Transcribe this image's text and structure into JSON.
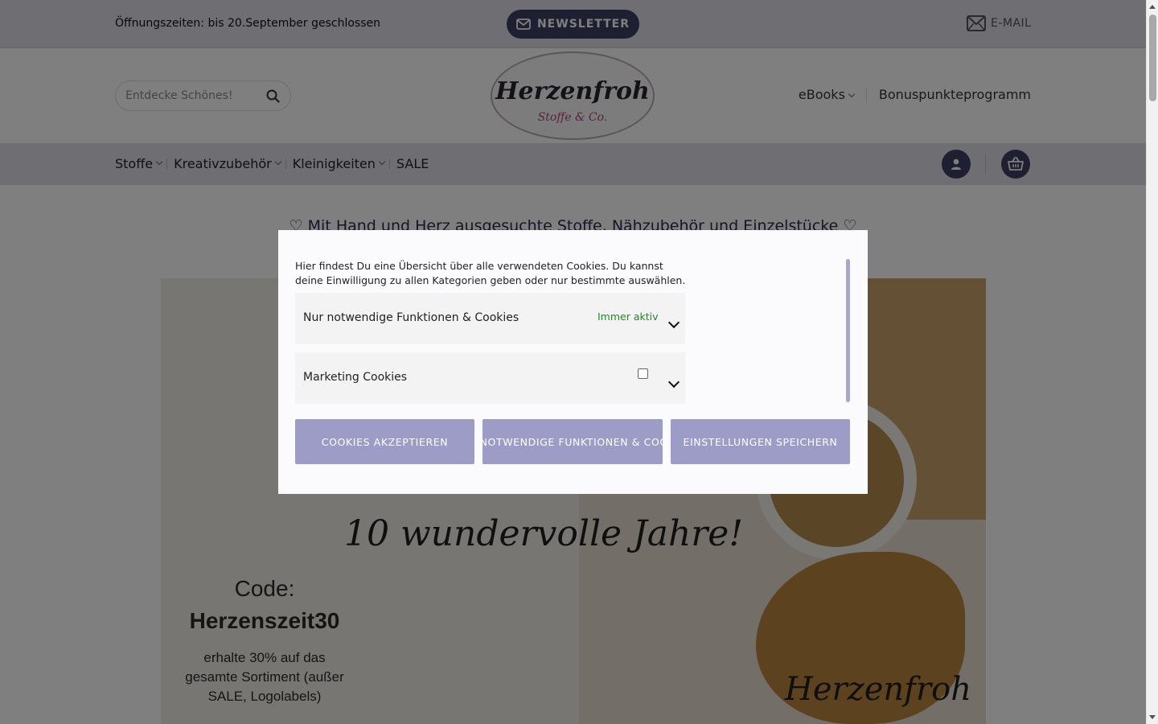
{
  "topbar": {
    "hours": "Öffnungszeiten: bis 20.September geschlossen",
    "newsletter_label": "NEWSLETTER",
    "email_label": "E-MAIL"
  },
  "header": {
    "search_placeholder": "Entdecke Schönes!",
    "logo_line1": "Herzenfroh",
    "logo_line2": "Stoffe & Co.",
    "links": [
      "eBooks",
      "Bonuspunkteprogramm"
    ]
  },
  "nav": {
    "items": [
      "Stoffe",
      "Kreativzubehör",
      "Kleinigkeiten",
      "SALE"
    ]
  },
  "tagline": "♡ Mit Hand und Herz ausgesuchte Stoffe, Nähzubehör und Einzelstücke ♡",
  "hero": {
    "script": "10 wundervolle Jahre!",
    "code_heading": "Code:",
    "code_value": "Herzenszeit30",
    "code_desc": "erhalte 30% auf das gesamte Sortiment (außer SALE, Logolabels)",
    "signature": "Herzenfroh"
  },
  "cookie": {
    "intro": "Hier findest Du eine Übersicht über alle verwendeten Cookies. Du kannst deine Einwilligung zu allen Kategorien geben oder nur bestimmte auswählen.",
    "categories": [
      {
        "title": "Nur notwendige Funktionen & Cookies",
        "status": "Immer aktiv"
      },
      {
        "title": "Marketing Cookies",
        "checked": false
      }
    ],
    "buttons": [
      "COOKIES AKZEPTIEREN",
      "NUR NOTWENDIGE FUNKTIONEN & COOKIES",
      "EINSTELLUNGEN SPEICHERN"
    ]
  },
  "colors": {
    "accent_dark": "#3f3f64",
    "bar_bg": "#dcdce6",
    "button_bg": "#9c9cc6",
    "status_green": "#1e8a1e"
  },
  "icons": [
    "envelope-icon",
    "search-icon",
    "user-icon",
    "basket-icon",
    "chevron-down-icon"
  ]
}
